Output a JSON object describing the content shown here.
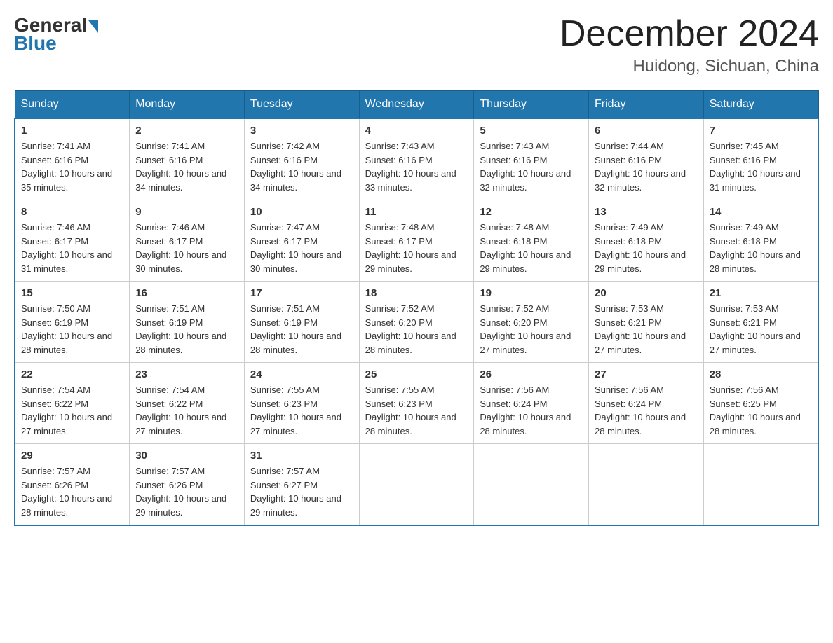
{
  "logo": {
    "general": "General",
    "blue": "Blue"
  },
  "title": "December 2024",
  "location": "Huidong, Sichuan, China",
  "headers": [
    "Sunday",
    "Monday",
    "Tuesday",
    "Wednesday",
    "Thursday",
    "Friday",
    "Saturday"
  ],
  "weeks": [
    [
      {
        "day": "1",
        "sunrise": "7:41 AM",
        "sunset": "6:16 PM",
        "daylight": "10 hours and 35 minutes."
      },
      {
        "day": "2",
        "sunrise": "7:41 AM",
        "sunset": "6:16 PM",
        "daylight": "10 hours and 34 minutes."
      },
      {
        "day": "3",
        "sunrise": "7:42 AM",
        "sunset": "6:16 PM",
        "daylight": "10 hours and 34 minutes."
      },
      {
        "day": "4",
        "sunrise": "7:43 AM",
        "sunset": "6:16 PM",
        "daylight": "10 hours and 33 minutes."
      },
      {
        "day": "5",
        "sunrise": "7:43 AM",
        "sunset": "6:16 PM",
        "daylight": "10 hours and 32 minutes."
      },
      {
        "day": "6",
        "sunrise": "7:44 AM",
        "sunset": "6:16 PM",
        "daylight": "10 hours and 32 minutes."
      },
      {
        "day": "7",
        "sunrise": "7:45 AM",
        "sunset": "6:16 PM",
        "daylight": "10 hours and 31 minutes."
      }
    ],
    [
      {
        "day": "8",
        "sunrise": "7:46 AM",
        "sunset": "6:17 PM",
        "daylight": "10 hours and 31 minutes."
      },
      {
        "day": "9",
        "sunrise": "7:46 AM",
        "sunset": "6:17 PM",
        "daylight": "10 hours and 30 minutes."
      },
      {
        "day": "10",
        "sunrise": "7:47 AM",
        "sunset": "6:17 PM",
        "daylight": "10 hours and 30 minutes."
      },
      {
        "day": "11",
        "sunrise": "7:48 AM",
        "sunset": "6:17 PM",
        "daylight": "10 hours and 29 minutes."
      },
      {
        "day": "12",
        "sunrise": "7:48 AM",
        "sunset": "6:18 PM",
        "daylight": "10 hours and 29 minutes."
      },
      {
        "day": "13",
        "sunrise": "7:49 AM",
        "sunset": "6:18 PM",
        "daylight": "10 hours and 29 minutes."
      },
      {
        "day": "14",
        "sunrise": "7:49 AM",
        "sunset": "6:18 PM",
        "daylight": "10 hours and 28 minutes."
      }
    ],
    [
      {
        "day": "15",
        "sunrise": "7:50 AM",
        "sunset": "6:19 PM",
        "daylight": "10 hours and 28 minutes."
      },
      {
        "day": "16",
        "sunrise": "7:51 AM",
        "sunset": "6:19 PM",
        "daylight": "10 hours and 28 minutes."
      },
      {
        "day": "17",
        "sunrise": "7:51 AM",
        "sunset": "6:19 PM",
        "daylight": "10 hours and 28 minutes."
      },
      {
        "day": "18",
        "sunrise": "7:52 AM",
        "sunset": "6:20 PM",
        "daylight": "10 hours and 28 minutes."
      },
      {
        "day": "19",
        "sunrise": "7:52 AM",
        "sunset": "6:20 PM",
        "daylight": "10 hours and 27 minutes."
      },
      {
        "day": "20",
        "sunrise": "7:53 AM",
        "sunset": "6:21 PM",
        "daylight": "10 hours and 27 minutes."
      },
      {
        "day": "21",
        "sunrise": "7:53 AM",
        "sunset": "6:21 PM",
        "daylight": "10 hours and 27 minutes."
      }
    ],
    [
      {
        "day": "22",
        "sunrise": "7:54 AM",
        "sunset": "6:22 PM",
        "daylight": "10 hours and 27 minutes."
      },
      {
        "day": "23",
        "sunrise": "7:54 AM",
        "sunset": "6:22 PM",
        "daylight": "10 hours and 27 minutes."
      },
      {
        "day": "24",
        "sunrise": "7:55 AM",
        "sunset": "6:23 PM",
        "daylight": "10 hours and 27 minutes."
      },
      {
        "day": "25",
        "sunrise": "7:55 AM",
        "sunset": "6:23 PM",
        "daylight": "10 hours and 28 minutes."
      },
      {
        "day": "26",
        "sunrise": "7:56 AM",
        "sunset": "6:24 PM",
        "daylight": "10 hours and 28 minutes."
      },
      {
        "day": "27",
        "sunrise": "7:56 AM",
        "sunset": "6:24 PM",
        "daylight": "10 hours and 28 minutes."
      },
      {
        "day": "28",
        "sunrise": "7:56 AM",
        "sunset": "6:25 PM",
        "daylight": "10 hours and 28 minutes."
      }
    ],
    [
      {
        "day": "29",
        "sunrise": "7:57 AM",
        "sunset": "6:26 PM",
        "daylight": "10 hours and 28 minutes."
      },
      {
        "day": "30",
        "sunrise": "7:57 AM",
        "sunset": "6:26 PM",
        "daylight": "10 hours and 29 minutes."
      },
      {
        "day": "31",
        "sunrise": "7:57 AM",
        "sunset": "6:27 PM",
        "daylight": "10 hours and 29 minutes."
      },
      null,
      null,
      null,
      null
    ]
  ],
  "labels": {
    "sunrise": "Sunrise:",
    "sunset": "Sunset:",
    "daylight": "Daylight:"
  }
}
